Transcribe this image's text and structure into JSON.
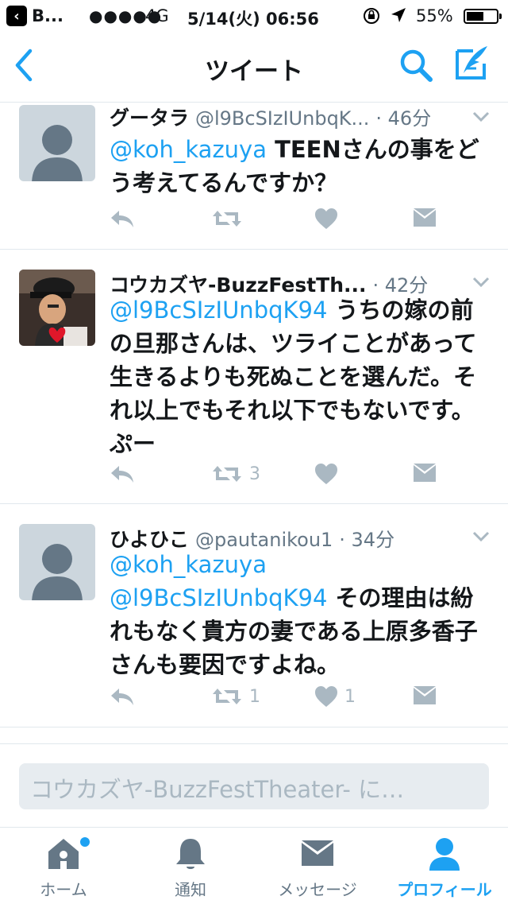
{
  "status_bar": {
    "back_app": "B...",
    "signal": "●●●●●",
    "network": "4G",
    "time": "5/14(火) 06:56",
    "battery_pct": "55%"
  },
  "nav": {
    "title": "ツイート"
  },
  "tweets": [
    {
      "name": "グータラ",
      "handle": "@l9BcSIzIUnbqK...",
      "time": "· 46分",
      "text_mentions": "@koh_kazuya",
      "text_rest": " TEENさんの事をどう考えてるんですか？",
      "retweets": "",
      "likes": ""
    },
    {
      "name": "コウカズヤ-BuzzFestTh...",
      "handle": "",
      "time": "· 42分",
      "text_mentions": "@l9BcSIzIUnbqK94",
      "text_rest": " うちの嫁の前の旦那さんは、ツライことがあって生きるよりも死ぬことを選んだ。それ以上でもそれ以下でもないです。ぷー",
      "retweets": "3",
      "likes": ""
    },
    {
      "name": "ひよひこ",
      "handle": "@pautanikou1",
      "time": "· 34分",
      "text_mentions": "@koh_kazuya",
      "text_mentions2": "@l9BcSIzIUnbqK94",
      "text_rest": " その理由は紛れもなく貴方の妻である上原多香子さんも要因ですよね。",
      "retweets": "1",
      "likes": "1"
    }
  ],
  "reply": {
    "placeholder": "コウカズヤ-BuzzFestTheater- に…"
  },
  "tabs": [
    {
      "label": "ホーム",
      "icon": "home-icon"
    },
    {
      "label": "通知",
      "icon": "bell-icon"
    },
    {
      "label": "メッセージ",
      "icon": "envelope-icon"
    },
    {
      "label": "プロフィール",
      "icon": "person-icon"
    }
  ],
  "colors": {
    "accent": "#1da1f2",
    "muted": "#aab8c2",
    "text": "#14171a",
    "secondary": "#657786"
  }
}
